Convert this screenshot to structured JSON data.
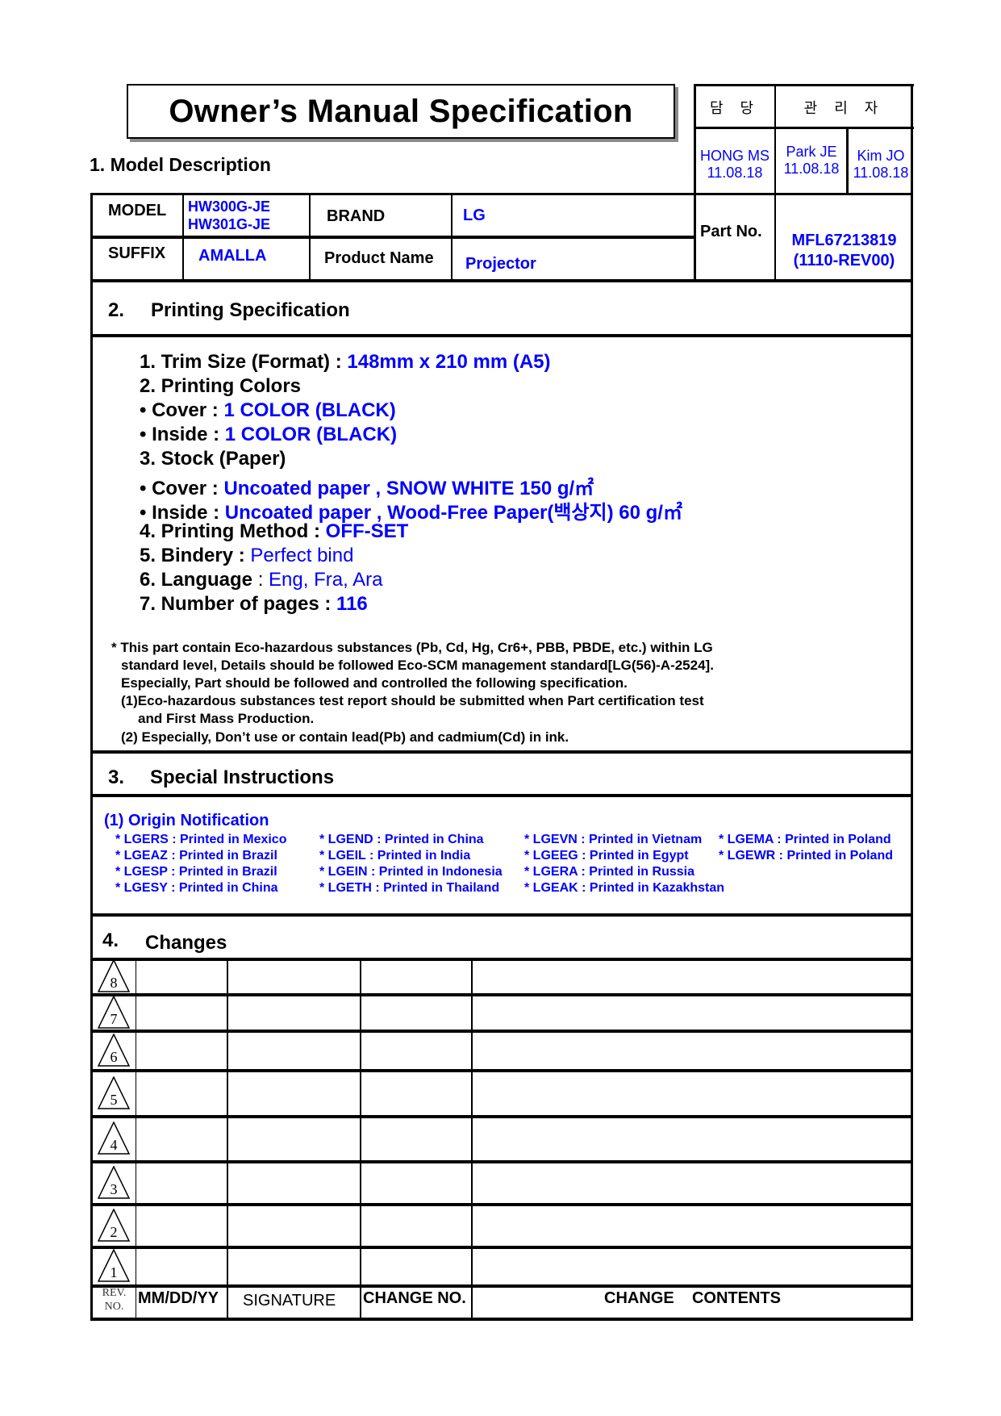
{
  "document": {
    "title": "Owner’s Manual Specification",
    "approval": {
      "headers": [
        "담 당",
        "관 리 자"
      ],
      "signers": [
        {
          "name": "HONG MS",
          "date": "11.08.18"
        },
        {
          "name": "Park JE",
          "date": "11.08.18"
        },
        {
          "name": "Kim JO",
          "date": "11.08.18"
        }
      ]
    },
    "section1": {
      "heading": "1. Model Description",
      "model_label": "MODEL",
      "model_values": [
        "HW300G-JE",
        "HW301G-JE"
      ],
      "brand_label": "BRAND",
      "brand_value": "LG",
      "suffix_label": "SUFFIX",
      "suffix_value": "AMALLA",
      "product_name_label": "Product Name",
      "product_name_value": "Projector",
      "part_no_label": "Part No.",
      "part_no_value": [
        "MFL67213819",
        "(1110-REV00)"
      ]
    },
    "section2": {
      "number": "2.",
      "heading": "Printing Specification",
      "items": [
        {
          "label": "1. Trim Size (Format) : ",
          "value": "148mm x 210 mm  (A5)"
        },
        {
          "label": "2. Printing Colors",
          "value": ""
        },
        {
          "label": "• Cover : ",
          "value": "1 COLOR (BLACK)"
        },
        {
          "label": "• Inside : ",
          "value": "1 COLOR (BLACK)"
        },
        {
          "label": "3. Stock (Paper)",
          "value": ""
        },
        {
          "label": "• Cover : ",
          "value": "Uncoated paper , SNOW WHITE 150 g/㎡"
        },
        {
          "label": "• Inside : ",
          "value": "Uncoated paper , Wood-Free Paper(백상지) 60 g/㎡"
        },
        {
          "label": "4. Printing Method : ",
          "value": "OFF-SET"
        },
        {
          "label": "5. Bindery  : ",
          "value": "Perfect bind"
        },
        {
          "label": "6. Language",
          "sep": " : ",
          "value": "Eng, Fra, Ara"
        },
        {
          "label": "7. Number of pages : ",
          "value": "116"
        }
      ],
      "note_lines": [
        "* This part contain Eco-hazardous substances (Pb, Cd, Hg, Cr6+, PBB, PBDE, etc.) within LG",
        "standard level, Details should be followed Eco-SCM management standard[LG(56)-A-2524].",
        "Especially, Part should be followed and controlled the following specification.",
        "(1)Eco-hazardous substances test report should be submitted when  Part certification test",
        "and First Mass Production.",
        "(2) Especially, Don’t use or contain lead(Pb) and cadmium(Cd) in ink."
      ]
    },
    "section3": {
      "number": "3.",
      "heading": "Special Instructions",
      "origin_title": "(1) Origin Notification",
      "origins": [
        [
          "* LGERS : Printed in Mexico",
          "* LGEAZ : Printed in Brazil",
          "* LGESP : Printed in Brazil",
          "* LGESY : Printed in China"
        ],
        [
          "* LGEND : Printed in China",
          "* LGEIL : Printed in India",
          "* LGEIN : Printed in Indonesia",
          "* LGETH : Printed in Thailand"
        ],
        [
          "* LGEVN : Printed in Vietnam",
          "* LGEEG : Printed in Egypt",
          "* LGERA : Printed in Russia",
          "* LGEAK : Printed in Kazakhstan"
        ],
        [
          "* LGEMA : Printed in Poland",
          "* LGEWR : Printed in Poland"
        ]
      ]
    },
    "section4": {
      "number": "4.",
      "heading": "Changes",
      "revisions": [
        "8",
        "7",
        "6",
        "5",
        "4",
        "3",
        "2",
        "1"
      ],
      "columns": {
        "rev_no": [
          "REV.",
          "NO."
        ],
        "date": "MM/DD/YY",
        "signature": "SIGNATURE",
        "change_no": "CHANGE NO.",
        "contents": "CHANGE    CONTENTS"
      }
    },
    "colors": {
      "value_text": "#0000ff",
      "label_text": "#000000"
    }
  }
}
